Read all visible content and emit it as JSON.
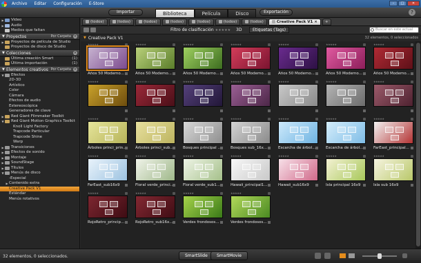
{
  "menu": [
    "Archivo",
    "Editar",
    "Configuración",
    "E-Store"
  ],
  "modebar": {
    "import": "Importar",
    "tabs": [
      "Biblioteca",
      "Película",
      "Disco"
    ],
    "active_tab": "Biblioteca",
    "export": "Exportación"
  },
  "sidebar": {
    "top_rows": [
      {
        "label": "Video",
        "tw": "▶",
        "color": "#7a9acb"
      },
      {
        "label": "Audio",
        "tw": "▶",
        "color": "#9fb7dd"
      },
      {
        "label": "Medios que faltan",
        "tw": "",
        "color": "#c9c9c9"
      }
    ],
    "proyectos": {
      "title": "Proyectos",
      "sort": "Por Carpeta",
      "rows": [
        {
          "label": "Proyectos de película de Studio",
          "tw": "▶"
        },
        {
          "label": "Proyectos de disco de Studio",
          "tw": ""
        }
      ]
    },
    "colecciones": {
      "title": "Colecciones",
      "rows": [
        {
          "label": "Última creación Smart",
          "count": "(1)"
        },
        {
          "label": "Última importación",
          "count": "(1)"
        }
      ]
    },
    "elementos": {
      "title": "Elementos creativos",
      "sort": "Por Carpeta",
      "rows": [
        {
          "label": "Efectos",
          "tw": "▼",
          "indent": 1,
          "icon": "fx"
        },
        {
          "label": "2D-3D",
          "indent": 2
        },
        {
          "label": "Artístico",
          "indent": 2
        },
        {
          "label": "Color",
          "indent": 2
        },
        {
          "label": "Cámara",
          "indent": 2
        },
        {
          "label": "Efectos de audio",
          "indent": 2
        },
        {
          "label": "Estereoscópica",
          "indent": 2
        },
        {
          "label": "Generadores de clave",
          "indent": 2
        },
        {
          "label": "Red Giant Filmmaker Toolkit",
          "tw": "▶",
          "indent": 1
        },
        {
          "label": "Red Giant Motion Graphics Toolkit",
          "tw": "▼",
          "indent": 1
        },
        {
          "label": "Knoll Light Factory",
          "indent": 3
        },
        {
          "label": "Trapcode Particular",
          "indent": 3
        },
        {
          "label": "Trapcode Shine",
          "indent": 3
        },
        {
          "label": "Warp",
          "indent": 3
        },
        {
          "label": "Transiciones",
          "tw": "▶",
          "indent": 1,
          "icon": "tr"
        },
        {
          "label": "Efectos de sonido",
          "tw": "▶",
          "indent": 1,
          "icon": "snd"
        },
        {
          "label": "Montaje",
          "tw": "▶",
          "indent": 1,
          "icon": "mon"
        },
        {
          "label": "SoundStage",
          "tw": "▶",
          "indent": 1,
          "icon": "ss"
        },
        {
          "label": "Títulos",
          "tw": "▶",
          "indent": 1,
          "icon": "tit"
        },
        {
          "label": "Menús de disco",
          "tw": "▼",
          "indent": 1,
          "icon": "menu"
        },
        {
          "label": "-Especial",
          "indent": 2
        },
        {
          "label": "Contenido extra",
          "tw": "▶",
          "indent": 2
        },
        {
          "label": "Creative Pack V1",
          "indent": 2,
          "selected": true
        },
        {
          "label": "Estándar",
          "indent": 2
        },
        {
          "label": "Menús rotativos",
          "indent": 2
        }
      ]
    }
  },
  "tabrow": {
    "tabs": [
      {
        "label": "(todos)"
      },
      {
        "label": "(todos)"
      },
      {
        "label": "(todos)"
      },
      {
        "label": "(todos)"
      },
      {
        "label": "(todos)"
      },
      {
        "label": "(todos)"
      },
      {
        "label": "(todos)"
      },
      {
        "label": "Creative Pack V1",
        "active": true
      }
    ],
    "plus": "+"
  },
  "filter": {
    "label": "Filtro de clasificación",
    "stars": "★★★★★",
    "three_d": "3D",
    "tags": "Etiquetas (Tags)",
    "search_placeholder": "Buscar en este actual"
  },
  "crumb": {
    "title": "Creative Pack V1",
    "count": "32 elementos, 0 seleccionados"
  },
  "grid": {
    "star_text": "★★★★★",
    "items": [
      {
        "caption": "Años 50 Modemo...",
        "c1": "#c7b3d0",
        "c2": "#7c4a8e",
        "selected": true
      },
      {
        "caption": "Años 50 Modemo...",
        "c1": "#b9d07a",
        "c2": "#5a7d2a"
      },
      {
        "caption": "Años 50 Modemo...",
        "c1": "#9fd060",
        "c2": "#3d6d20"
      },
      {
        "caption": "Años 50 Modemo...",
        "c1": "#d33d5a",
        "c2": "#7b1430"
      },
      {
        "caption": "Años 50 Modemo...",
        "c1": "#6a2b8e",
        "c2": "#2d1144"
      },
      {
        "caption": "Años 50 Modemo...",
        "c1": "#e05aa0",
        "c2": "#8d1e5a"
      },
      {
        "caption": "Años 50 Modemo...",
        "c1": "#b02a34",
        "c2": "#5e1018"
      },
      {
        "caption": "",
        "c1": "#c9a12a",
        "c2": "#6e4d0e"
      },
      {
        "caption": "",
        "c1": "#9b2838",
        "c2": "#4a0f18"
      },
      {
        "caption": "",
        "c1": "#54407a",
        "c2": "#221738"
      },
      {
        "caption": "",
        "c1": "#9a5f94",
        "c2": "#4d2748"
      },
      {
        "caption": "",
        "c1": "#c8c8c8",
        "c2": "#8a8a8a"
      },
      {
        "caption": "",
        "c1": "#b3b3b3",
        "c2": "#6c6c6c"
      },
      {
        "caption": "",
        "c1": "#9b5a6a",
        "c2": "#4e2230"
      },
      {
        "caption": "Árboles princi_prin...",
        "c1": "#e5e49a",
        "c2": "#b7b45a"
      },
      {
        "caption": "Árboles princi_sub...",
        "c1": "#e7e09e",
        "c2": "#bdb460"
      },
      {
        "caption": "Bosques principal ...",
        "c1": "#d7d7d7",
        "c2": "#8f8f8f"
      },
      {
        "caption": "Bosques sub_16x...",
        "c1": "#d3d3d3",
        "c2": "#8a8a8a"
      },
      {
        "caption": "Escarcha de árbol...",
        "c1": "#cde9fb",
        "c2": "#6fb4e2"
      },
      {
        "caption": "Escarcha de árbol...",
        "c1": "#d4edfb",
        "c2": "#7fbde6"
      },
      {
        "caption": "FarEast_principal...",
        "c1": "#f2f2f2",
        "c2": "#b43434"
      },
      {
        "caption": "FarEast_sub16x9",
        "c1": "#e9f3fb",
        "c2": "#9cc2e0"
      },
      {
        "caption": "Floral verde_princi...",
        "c1": "#f0f3e9",
        "c2": "#9fb88a"
      },
      {
        "caption": "Floral verde_sub1...",
        "c1": "#eef4e6",
        "c2": "#a5c08a"
      },
      {
        "caption": "Hawaii_principal1...",
        "c1": "#f7f7f7",
        "c2": "#c9c9c9"
      },
      {
        "caption": "Hawaii_sub16x9",
        "c1": "#f7e0e8",
        "c2": "#d06a8a"
      },
      {
        "caption": "Isla principal 16x9",
        "c1": "#f3f1d3",
        "c2": "#a8c85a"
      },
      {
        "caption": "Isla sub 16x9",
        "c1": "#f6f4e0",
        "c2": "#b9c86a"
      },
      {
        "caption": "RojoRetro_princip...",
        "c1": "#7d2630",
        "c2": "#3e0c13"
      },
      {
        "caption": "RojoRetro_sub16x...",
        "c1": "#842832",
        "c2": "#3f0d14"
      },
      {
        "caption": "Verdes frondosos...",
        "c1": "#a6d34a",
        "c2": "#3a7a18"
      },
      {
        "caption": "Verdes frondosos...",
        "c1": "#b2d85a",
        "c2": "#4a8a22"
      }
    ]
  },
  "bottombar": {
    "status": "32 elementos, 0 seleccionados.",
    "smartslide": "SmartSlide",
    "smartmovie": "SmartMovie"
  }
}
